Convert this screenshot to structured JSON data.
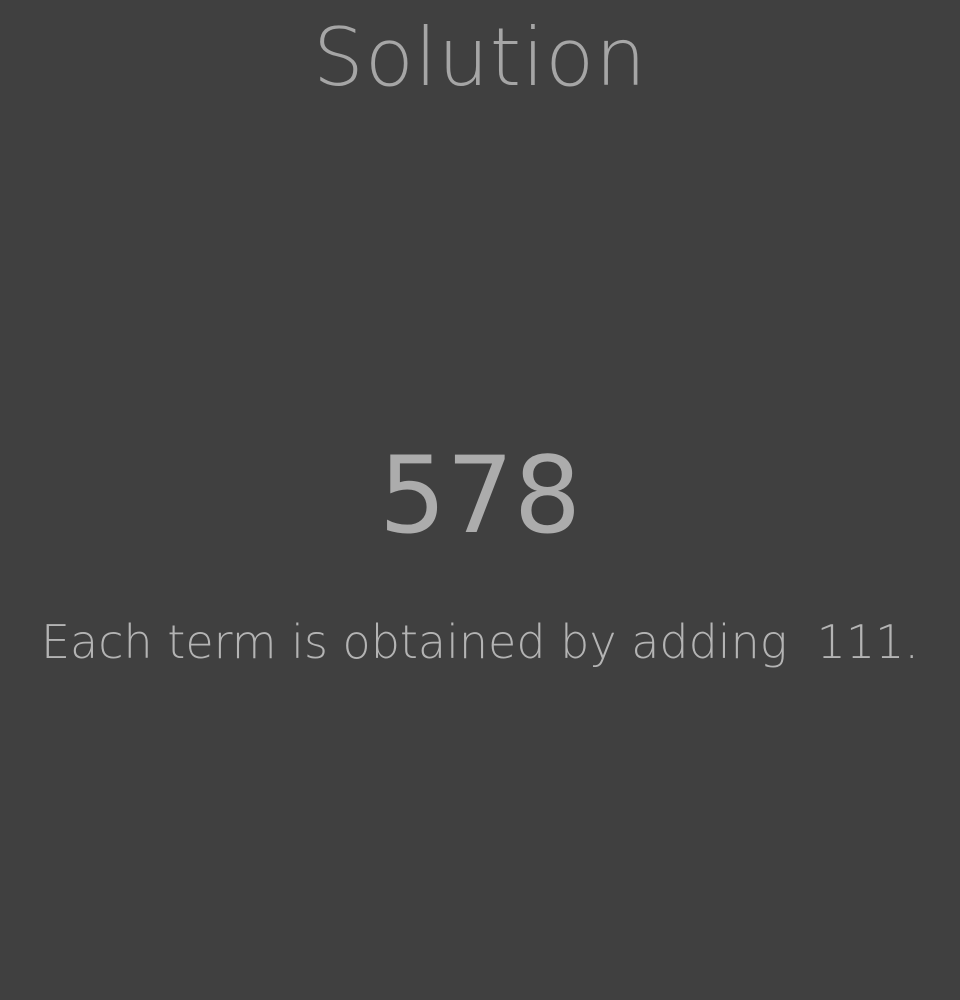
{
  "page": {
    "title": "Solution",
    "answer": "578",
    "explanation": "Each term is obtained by adding  111."
  },
  "colors": {
    "background": "#404040",
    "text": "#a8a8a8"
  }
}
